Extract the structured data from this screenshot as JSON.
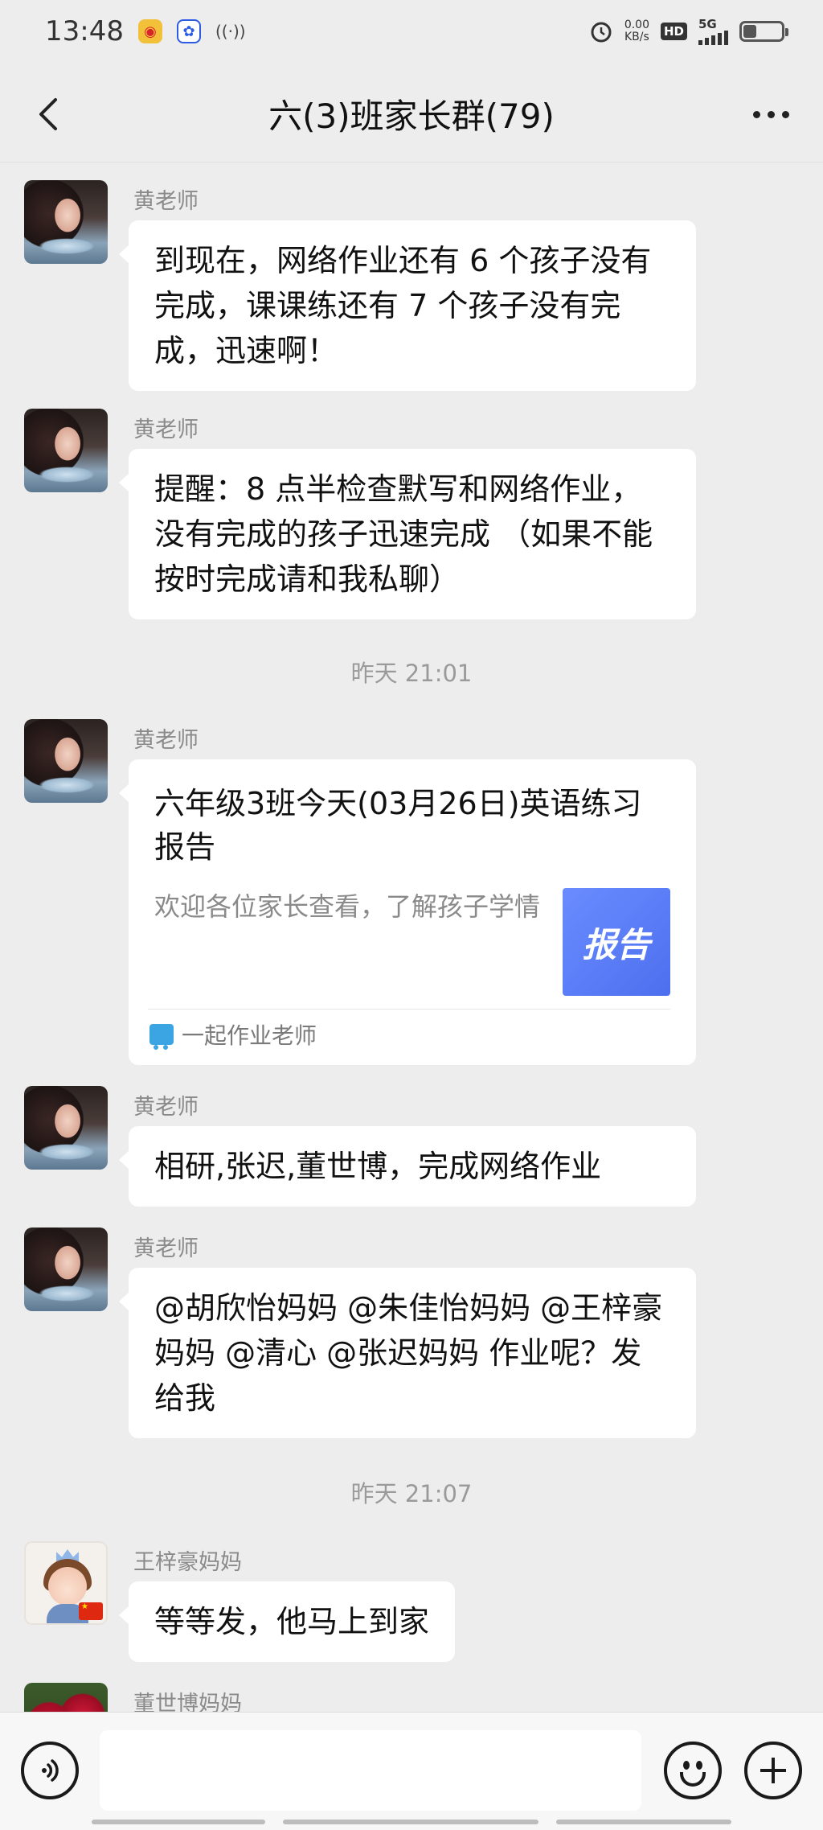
{
  "status_bar": {
    "time": "13:48",
    "net_speed_value": "0.00",
    "net_speed_unit": "KB/s",
    "hd": "HD",
    "network": "5G",
    "battery_level": 0.35
  },
  "header": {
    "title": "六(3)班家长群(79)"
  },
  "messages": [
    {
      "sender": "黄老师",
      "text": "到现在，网络作业还有 6 个孩子没有完成，课课练还有 7 个孩子没有完成，迅速啊！"
    },
    {
      "sender": "黄老师",
      "text": "提醒：8 点半检查默写和网络作业，没有完成的孩子迅速完成 （如果不能按时完成请和我私聊）"
    },
    {
      "time": "昨天 21:01"
    },
    {
      "sender": "黄老师",
      "card": {
        "title": "六年级3班今天(03月26日)英语练习报告",
        "desc": "欢迎各位家长查看，了解孩子学情",
        "thumb": "报告",
        "source": "一起作业老师"
      }
    },
    {
      "sender": "黄老师",
      "text": "相研,张迟,董世博，完成网络作业"
    },
    {
      "sender": "黄老师",
      "text": "@胡欣怡妈妈 @朱佳怡妈妈 @王梓豪妈妈 @清心 @张迟妈妈 作业呢？发给我"
    },
    {
      "time": "昨天 21:07"
    },
    {
      "sender": "王梓豪妈妈",
      "text": "等等发，他马上到家"
    },
    {
      "sender": "董世博妈妈"
    }
  ]
}
